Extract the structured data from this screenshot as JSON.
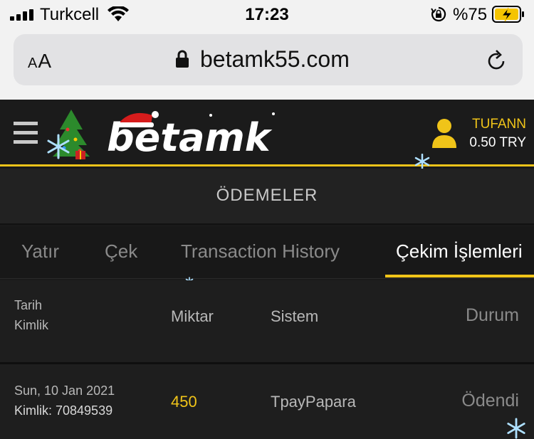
{
  "statusbar": {
    "carrier": "Turkcell",
    "time": "17:23",
    "battery": "%75"
  },
  "browser": {
    "text_size_label": "AA",
    "url": "betamk55.com"
  },
  "header": {
    "logo_text": "betamk",
    "username": "TUFANN",
    "balance": "0.50 TRY"
  },
  "page": {
    "title": "ÖDEMELER"
  },
  "tabs": [
    {
      "label": "Yatır",
      "active": false
    },
    {
      "label": "Çek",
      "active": false
    },
    {
      "label": "Transaction History",
      "active": false
    },
    {
      "label": "Çekim İşlemleri",
      "active": true
    }
  ],
  "table": {
    "headers": {
      "date": "Tarih",
      "id": "Kimlik",
      "amount": "Miktar",
      "system": "Sistem",
      "status": "Durum"
    },
    "rows": [
      {
        "date": "Sun, 10 Jan 2021",
        "id": "Kimlik: 70849539",
        "amount": "450",
        "system": "TpayPapara",
        "status": "Ödendi"
      }
    ]
  },
  "colors": {
    "accent": "#f0c419",
    "background": "#1a1a1a",
    "text_muted": "#8a8a8a"
  },
  "icons": [
    "signal-icon",
    "wifi-icon",
    "orientation-lock-icon",
    "battery-charging-icon",
    "lock-icon",
    "reload-icon",
    "menu-icon",
    "user-icon",
    "snowflake-icon"
  ]
}
